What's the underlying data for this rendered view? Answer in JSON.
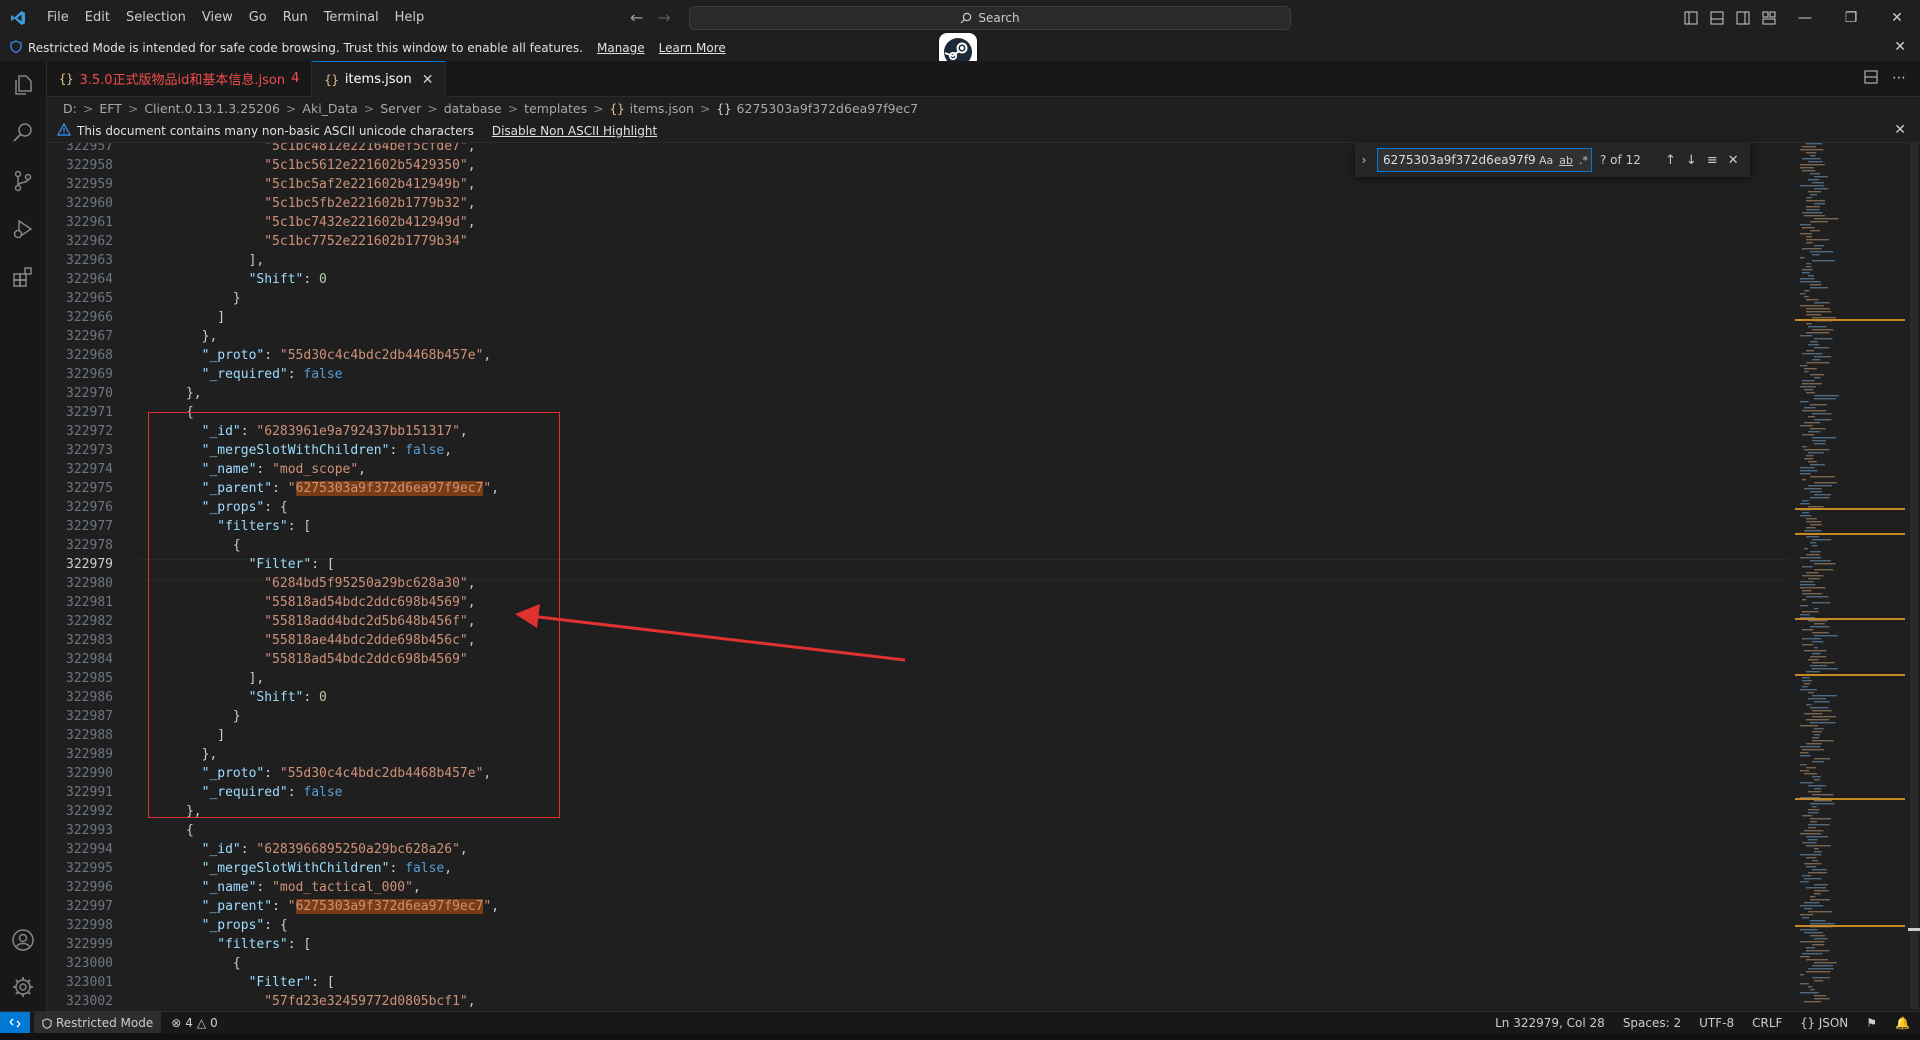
{
  "menu": [
    "File",
    "Edit",
    "Selection",
    "View",
    "Go",
    "Run",
    "Terminal",
    "Help"
  ],
  "search_label": "Search",
  "restricted_banner": {
    "text": "Restricted Mode is intended for safe code browsing. Trust this window to enable all features.",
    "manage": "Manage",
    "learn_more": "Learn More"
  },
  "tabs": [
    {
      "label": "3.5.0正式版物品id和基本信息.json",
      "count": "4",
      "active": false
    },
    {
      "label": "items.json",
      "active": true
    }
  ],
  "breadcrumb": [
    "D:",
    "EFT",
    "Client.0.13.1.3.25206",
    "Aki_Data",
    "Server",
    "database",
    "templates",
    "items.json",
    "6275303a9f372d6ea97f9ec7"
  ],
  "ascii_warning": {
    "text": "This document contains many non-basic ASCII unicode characters",
    "action": "Disable Non ASCII Highlight"
  },
  "find_widget": {
    "value": "6275303a9f372d6ea97f9ec7",
    "case_label": "Aa",
    "word_label": "ab",
    "regex_label": ".*",
    "count": "? of 12"
  },
  "editor": {
    "current_line": "322979",
    "lines": [
      {
        "n": "322957",
        "c": "                \"5c1bc4812e22164bef5cfde7\","
      },
      {
        "n": "322958",
        "c": "                \"5c1bc5612e221602b5429350\","
      },
      {
        "n": "322959",
        "c": "                \"5c1bc5af2e221602b412949b\","
      },
      {
        "n": "322960",
        "c": "                \"5c1bc5fb2e221602b1779b32\","
      },
      {
        "n": "322961",
        "c": "                \"5c1bc7432e221602b412949d\","
      },
      {
        "n": "322962",
        "c": "                \"5c1bc7752e221602b1779b34\""
      },
      {
        "n": "322963",
        "c": "              ],"
      },
      {
        "n": "322964",
        "c": "              \"Shift\": 0"
      },
      {
        "n": "322965",
        "c": "            }"
      },
      {
        "n": "322966",
        "c": "          ]"
      },
      {
        "n": "322967",
        "c": "        },"
      },
      {
        "n": "322968",
        "c": "        \"_proto\": \"55d30c4c4bdc2db4468b457e\","
      },
      {
        "n": "322969",
        "c": "        \"_required\": false"
      },
      {
        "n": "322970",
        "c": "      },"
      },
      {
        "n": "322971",
        "c": "      {"
      },
      {
        "n": "322972",
        "c": "        \"_id\": \"6283961e9a792437bb151317\","
      },
      {
        "n": "322973",
        "c": "        \"_mergeSlotWithChildren\": false,"
      },
      {
        "n": "322974",
        "c": "        \"_name\": \"mod_scope\","
      },
      {
        "n": "322975",
        "c": "        \"_parent\": \"6275303a9f372d6ea97f9ec7\","
      },
      {
        "n": "322976",
        "c": "        \"_props\": {"
      },
      {
        "n": "322977",
        "c": "          \"filters\": ["
      },
      {
        "n": "322978",
        "c": "            {"
      },
      {
        "n": "322979",
        "c": "              \"Filter\": ["
      },
      {
        "n": "322980",
        "c": "                \"6284bd5f95250a29bc628a30\","
      },
      {
        "n": "322981",
        "c": "                \"55818ad54bdc2ddc698b4569\","
      },
      {
        "n": "322982",
        "c": "                \"55818add4bdc2d5b648b456f\","
      },
      {
        "n": "322983",
        "c": "                \"55818ae44bdc2dde698b456c\","
      },
      {
        "n": "322984",
        "c": "                \"55818ad54bdc2ddc698b4569\""
      },
      {
        "n": "322985",
        "c": "              ],"
      },
      {
        "n": "322986",
        "c": "              \"Shift\": 0"
      },
      {
        "n": "322987",
        "c": "            }"
      },
      {
        "n": "322988",
        "c": "          ]"
      },
      {
        "n": "322989",
        "c": "        },"
      },
      {
        "n": "322990",
        "c": "        \"_proto\": \"55d30c4c4bdc2db4468b457e\","
      },
      {
        "n": "322991",
        "c": "        \"_required\": false"
      },
      {
        "n": "322992",
        "c": "      },"
      },
      {
        "n": "322993",
        "c": "      {"
      },
      {
        "n": "322994",
        "c": "        \"_id\": \"6283966895250a29bc628a26\","
      },
      {
        "n": "322995",
        "c": "        \"_mergeSlotWithChildren\": false,"
      },
      {
        "n": "322996",
        "c": "        \"_name\": \"mod_tactical_000\","
      },
      {
        "n": "322997",
        "c": "        \"_parent\": \"6275303a9f372d6ea97f9ec7\","
      },
      {
        "n": "322998",
        "c": "        \"_props\": {"
      },
      {
        "n": "322999",
        "c": "          \"filters\": ["
      },
      {
        "n": "323000",
        "c": "            {"
      },
      {
        "n": "323001",
        "c": "              \"Filter\": ["
      },
      {
        "n": "323002",
        "c": "                \"57fd23e32459772d0805bcf1\","
      }
    ]
  },
  "statusbar": {
    "restricted": "Restricted Mode",
    "errors": "4",
    "warnings": "0",
    "position": "Ln 322979, Col 28",
    "spaces": "Spaces: 2",
    "encoding": "UTF-8",
    "eol": "CRLF",
    "language": "JSON"
  },
  "colors": {
    "accent": "#0078d4",
    "find_highlight": "#7a3c14",
    "annotation_red": "#e03131"
  }
}
